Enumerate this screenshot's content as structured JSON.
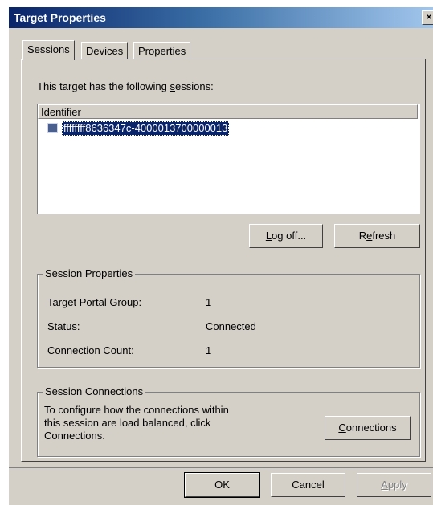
{
  "window": {
    "title": "Target Properties",
    "close_glyph": "×",
    "close_icon": "close-icon"
  },
  "tabs": [
    {
      "label": "Sessions",
      "active": true
    },
    {
      "label": "Devices",
      "active": false
    },
    {
      "label": "Properties",
      "active": false
    }
  ],
  "sessions": {
    "intro_pre": "This target has the following ",
    "intro_u": "s",
    "intro_post": "essions:",
    "column_header": "Identifier",
    "rows": [
      {
        "identifier": "ffffffff8636347c-4000013700000013",
        "checked": false,
        "selected": true
      }
    ],
    "logoff_u": "L",
    "logoff_rest": "og off...",
    "refresh_pre": "R",
    "refresh_u": "e",
    "refresh_rest": "fresh"
  },
  "session_properties": {
    "legend": "Session Properties",
    "target_portal_group_label": "Target Portal Group:",
    "target_portal_group_value": "1",
    "status_label": "Status:",
    "status_value": "Connected",
    "connection_count_label": "Connection Count:",
    "connection_count_value": "1"
  },
  "session_connections": {
    "legend": "Session Connections",
    "description_line1": "To configure how the connections within",
    "description_line2": "this session are load balanced, click",
    "description_line3": "Connections.",
    "connections_u": "C",
    "connections_rest": "onnections"
  },
  "footer": {
    "ok": "OK",
    "cancel": "Cancel",
    "apply_u": "A",
    "apply_rest": "pply",
    "apply_enabled": false
  },
  "colors": {
    "titlebar_start": "#0a246a",
    "titlebar_end": "#a6caf0",
    "face": "#d4d0c8",
    "selection": "#0a246a"
  }
}
